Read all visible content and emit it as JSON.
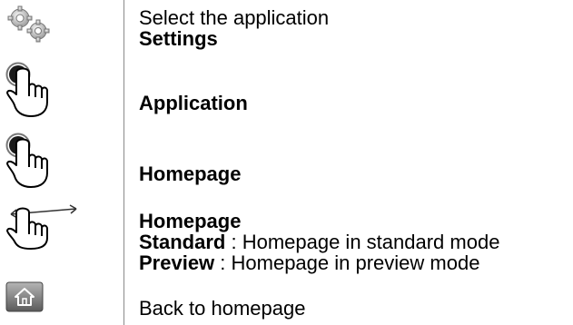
{
  "steps": [
    {
      "icon": "gears-icon",
      "lines": [
        {
          "normal": "Select the application"
        },
        {
          "bold": "Settings"
        }
      ]
    },
    {
      "icon": "tap-hand-icon",
      "lines": [
        {
          "bold": "Application"
        }
      ]
    },
    {
      "icon": "tap-hand-icon",
      "lines": [
        {
          "bold": "Homepage"
        }
      ]
    },
    {
      "icon": "swipe-hand-icon",
      "lines": [
        {
          "bold": "Homepage"
        },
        {
          "bold": "Standard",
          "normal": " : Homepage in standard mode"
        },
        {
          "bold": "Preview",
          "normal": " : Homepage in preview mode"
        }
      ]
    },
    {
      "icon": "home-button-icon",
      "lines": [
        {
          "normal": "Back to homepage"
        }
      ]
    }
  ]
}
